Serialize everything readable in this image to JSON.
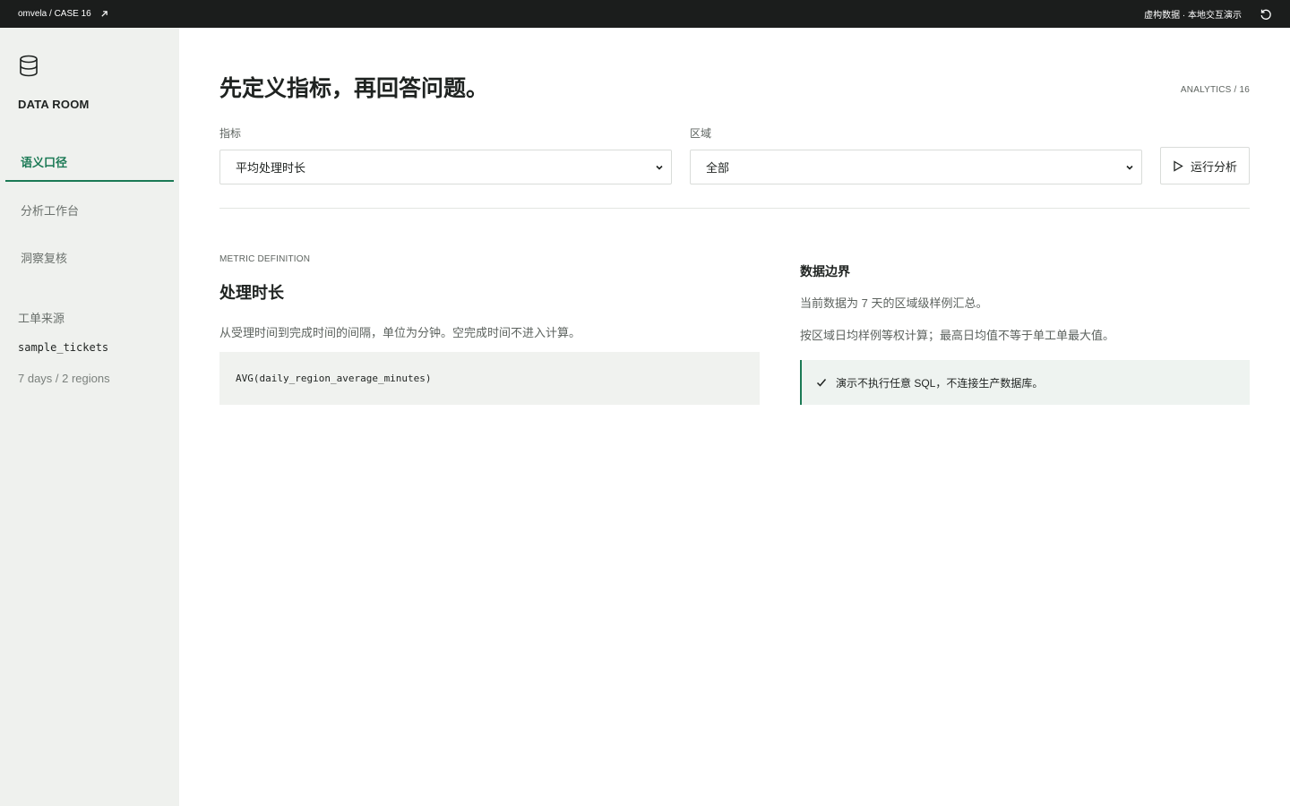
{
  "topbar": {
    "brand": "omvela / CASE 16",
    "mode_label": "虚构数据 · 本地交互演示",
    "icons": {
      "external": "arrow-up-right-icon",
      "reload": "reload-icon"
    }
  },
  "sidebar": {
    "title": "DATA ROOM",
    "logo_icon": "database-icon",
    "nav": [
      {
        "label": "语义口径",
        "active": true
      },
      {
        "label": "分析工作台",
        "active": false
      },
      {
        "label": "洞察复核",
        "active": false
      }
    ],
    "source": {
      "label": "工单来源",
      "table": "sample_tickets",
      "meta": "7 days / 2 regions"
    }
  },
  "header": {
    "title": "先定义指标，再回答问题。",
    "code": "ANALYTICS / 16"
  },
  "controls": {
    "metric": {
      "label": "指标",
      "value": "平均处理时长"
    },
    "region": {
      "label": "区域",
      "value": "全部"
    },
    "run_label": "运行分析"
  },
  "definition": {
    "eyebrow": "METRIC DEFINITION",
    "name": "处理时长",
    "description": "从受理时间到完成时间的间隔，单位为分钟。空完成时间不进入计算。",
    "formula": "AVG(daily_region_average_minutes)"
  },
  "boundary": {
    "title": "数据边界",
    "lines": [
      "当前数据为 7 天的区域级样例汇总。",
      "按区域日均样例等权计算；最高日均值不等于单工单最大值。"
    ],
    "note": "演示不执行任意 SQL，不连接生产数据库。"
  },
  "colors": {
    "accent": "#1b7a55",
    "topbar": "#1b1d1c",
    "sidebar": "#eff1ee"
  }
}
